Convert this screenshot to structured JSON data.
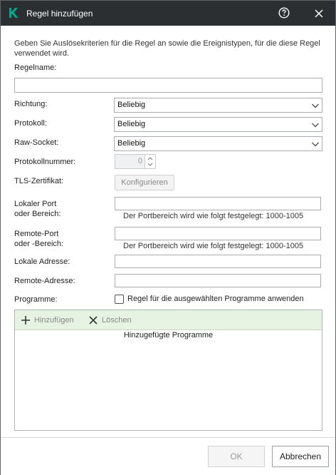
{
  "window": {
    "title": "Regel hinzufügen",
    "logo_icon": "kaspersky-k-icon",
    "accent_color": "#00a88e"
  },
  "description": "Geben Sie Auslösekriterien für die Regel an sowie die Ereignistypen, für die diese Regel verwendet wird.",
  "form": {
    "rule_name_label": "Regelname:",
    "rule_name_value": "",
    "direction_label": "Richtung:",
    "direction_value": "Beliebig",
    "protocol_label": "Protokoll:",
    "protocol_value": "Beliebig",
    "raw_socket_label": "Raw-Socket:",
    "raw_socket_value": "Beliebig",
    "protocol_number_label": "Protokollnummer:",
    "protocol_number_value": "0",
    "tls_label": "TLS-Zertifikat:",
    "configure_button": "Konfigurieren",
    "local_port_label_1": "Lokaler Port",
    "local_port_label_2": "oder Bereich:",
    "local_port_value": "",
    "local_port_hint": "Der Portbereich wird wie folgt festgelegt: 1000-1005",
    "remote_port_label_1": "Remote-Port",
    "remote_port_label_2": "oder -Bereich:",
    "remote_port_value": "",
    "remote_port_hint": "Der Portbereich wird wie folgt festgelegt: 1000-1005",
    "local_address_label": "Lokale Adresse:",
    "local_address_value": "",
    "remote_address_label": "Remote-Adresse:",
    "remote_address_value": "",
    "programs_label": "Programme:",
    "apply_programs_checkbox_label": "Regel für die ausgewählten Programme anwenden",
    "apply_programs_checked": false
  },
  "programs": {
    "add_label": "Hinzufügen",
    "delete_label": "Löschen",
    "column_header": "Hinzugefügte Programme",
    "items": []
  },
  "footer": {
    "ok_label": "OK",
    "cancel_label": "Abbrechen"
  }
}
